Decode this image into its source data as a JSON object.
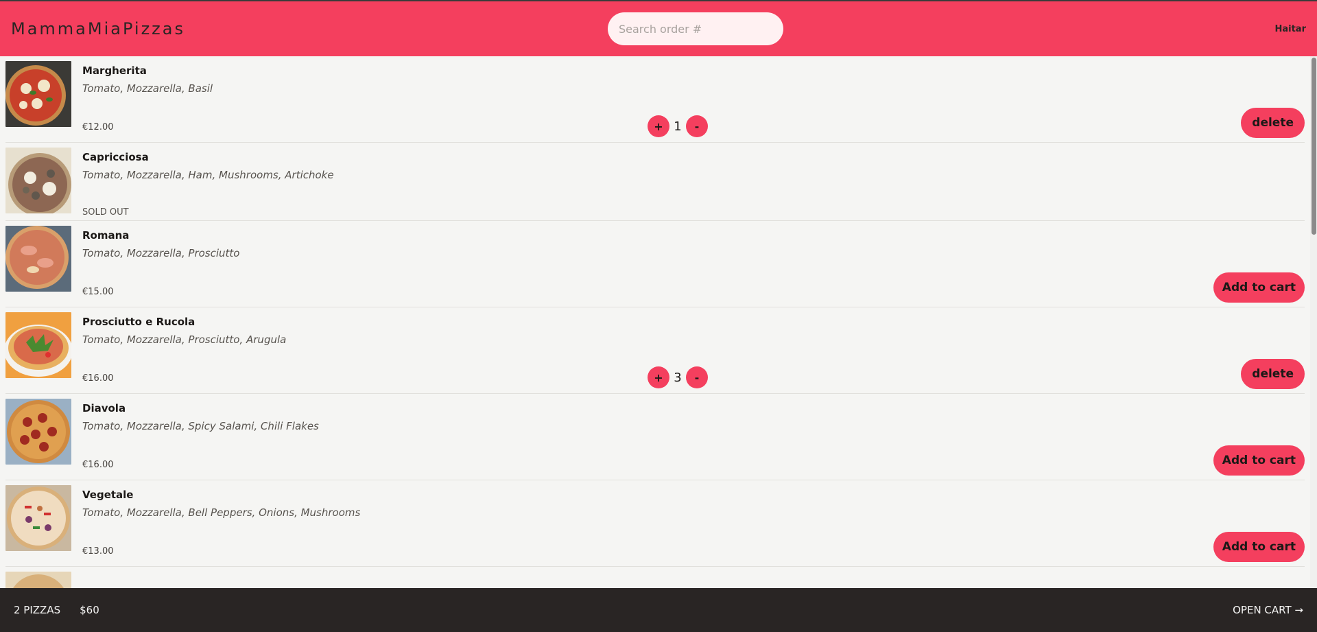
{
  "header": {
    "logo": "MammaMiaPizzas",
    "search_placeholder": "Search order #",
    "username": "Haitar"
  },
  "menu": [
    {
      "name": "Margherita",
      "ingredients": "Tomato, Mozzarella, Basil",
      "price": "€12.00",
      "sold_out": false,
      "quantity": "1",
      "action": "delete"
    },
    {
      "name": "Capricciosa",
      "ingredients": "Tomato, Mozzarella, Ham, Mushrooms, Artichoke",
      "status": "SOLD OUT",
      "sold_out": true
    },
    {
      "name": "Romana",
      "ingredients": "Tomato, Mozzarella, Prosciutto",
      "price": "€15.00",
      "sold_out": false,
      "action": "Add to cart"
    },
    {
      "name": "Prosciutto e Rucola",
      "ingredients": "Tomato, Mozzarella, Prosciutto, Arugula",
      "price": "€16.00",
      "sold_out": false,
      "quantity": "3",
      "action": "delete"
    },
    {
      "name": "Diavola",
      "ingredients": "Tomato, Mozzarella, Spicy Salami, Chili Flakes",
      "price": "€16.00",
      "sold_out": false,
      "action": "Add to cart"
    },
    {
      "name": "Vegetale",
      "ingredients": "Tomato, Mozzarella, Bell Peppers, Onions, Mushrooms",
      "price": "€13.00",
      "sold_out": false,
      "action": "Add to cart"
    }
  ],
  "qty_controls": {
    "increase": "+",
    "decrease": "-"
  },
  "footer": {
    "pizza_count": "2 PIZZAS",
    "total": "$60",
    "open_cart": "OPEN CART →"
  },
  "colors": {
    "accent": "#f43f5e",
    "footer_bg": "#292524",
    "page_bg": "#f5f5f3"
  }
}
